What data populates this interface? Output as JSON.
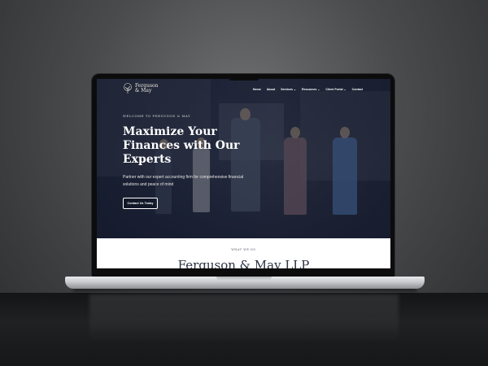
{
  "nav": {
    "logo_line1": "Ferguson",
    "logo_line2": "& May",
    "items": [
      "Home",
      "About",
      "Services ⌄",
      "Resources ⌄",
      "Client Portal ⌄",
      "Contact"
    ]
  },
  "hero": {
    "eyebrow": "WELCOME TO FERGUSON & MAY",
    "headline": "Maximize Your Finances with Our Experts",
    "subtext": "Partner with our expert accounting firm for comprehensive financial solutions and peace of mind",
    "cta_label": "Contact Us Today"
  },
  "section": {
    "eyebrow": "WHAT WE DO",
    "title": "Ferguson & May LLP"
  },
  "colors": {
    "hero_overlay": "#1d2436",
    "section_bg": "#ffffff",
    "title_text": "#2b3142"
  }
}
